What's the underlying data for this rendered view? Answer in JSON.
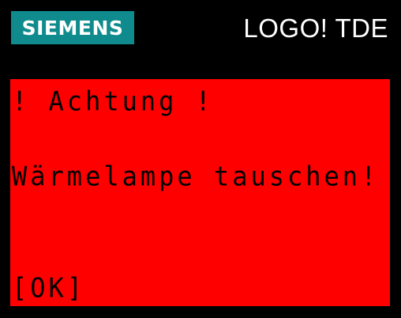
{
  "header": {
    "brand": "SIEMENS",
    "device_title": "LOGO! TDE"
  },
  "display": {
    "line1": "! Achtung !",
    "line2": "Wärmelampe tauschen!",
    "ok_label": "[OK]"
  },
  "colors": {
    "background": "#000000",
    "brand_teal": "#0f8b8d",
    "display_red": "#ff0000",
    "display_text": "#000000",
    "header_text": "#ffffff"
  }
}
